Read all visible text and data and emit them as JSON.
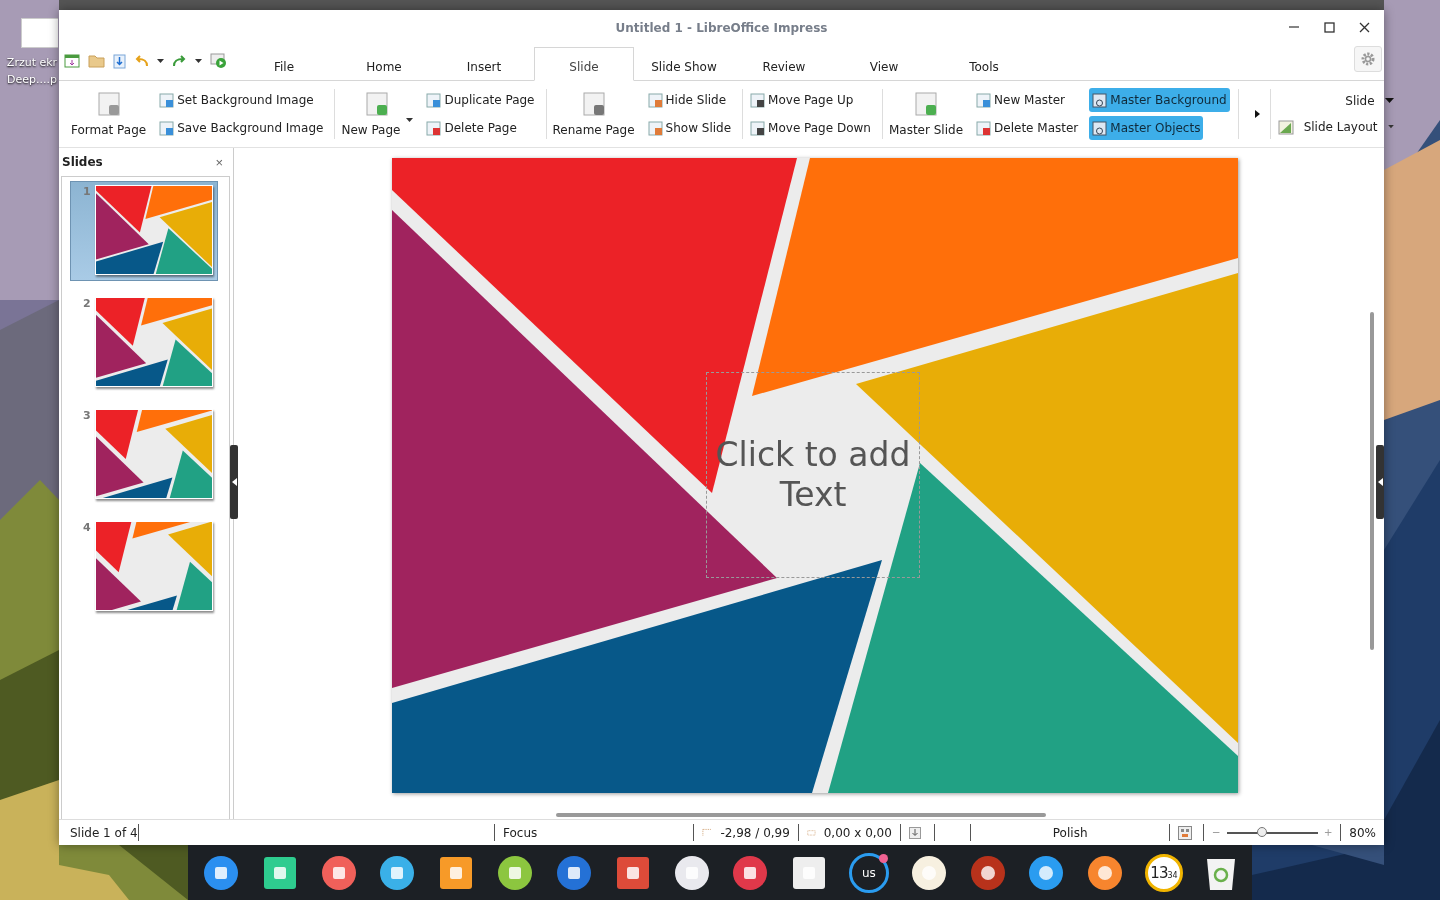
{
  "desktop_icon": {
    "label_line_1": "Zrzut ekr",
    "label_line_2": "Deep....p"
  },
  "window": {
    "title": "Untitled 1 - LibreOffice Impress"
  },
  "tabs": [
    {
      "label": "File",
      "selected": false
    },
    {
      "label": "Home",
      "selected": false
    },
    {
      "label": "Insert",
      "selected": false
    },
    {
      "label": "Slide",
      "selected": true
    },
    {
      "label": "Slide Show",
      "selected": false
    },
    {
      "label": "Review",
      "selected": false
    },
    {
      "label": "View",
      "selected": false
    },
    {
      "label": "Tools",
      "selected": false
    }
  ],
  "ribbon": {
    "groups": [
      {
        "items": [
          {
            "kind": "large",
            "label": "Format Page"
          },
          {
            "kind": "small",
            "label": "Set Background Image"
          },
          {
            "kind": "small",
            "label": "Save Background Image"
          }
        ]
      },
      {
        "items": [
          {
            "kind": "large",
            "label": "New Page",
            "dropdown": true
          },
          {
            "kind": "small",
            "label": "Duplicate Page"
          },
          {
            "kind": "small",
            "label": "Delete Page"
          }
        ]
      },
      {
        "items": [
          {
            "kind": "large",
            "label": "Rename Page"
          },
          {
            "kind": "small",
            "label": "Hide Slide"
          },
          {
            "kind": "small",
            "label": "Show Slide"
          }
        ]
      },
      {
        "items": [
          {
            "kind": "small",
            "label": "Move Page Up"
          },
          {
            "kind": "small",
            "label": "Move Page Down"
          }
        ]
      },
      {
        "items": [
          {
            "kind": "large",
            "label": "Master Slide"
          },
          {
            "kind": "small",
            "label": "New Master"
          },
          {
            "kind": "small",
            "label": "Delete Master"
          },
          {
            "kind": "toggle",
            "label": "Master Background",
            "on": true
          },
          {
            "kind": "toggle",
            "label": "Master Objects",
            "on": true
          }
        ]
      }
    ],
    "right": {
      "slide_menu": "Slide",
      "layout_menu": "Slide Layout"
    }
  },
  "slide_pane": {
    "title": "Slides",
    "close": "×",
    "slides": [
      {
        "number": "1",
        "selected": true
      },
      {
        "number": "2",
        "selected": false
      },
      {
        "number": "3",
        "selected": false
      },
      {
        "number": "4",
        "selected": false
      }
    ]
  },
  "slide": {
    "placeholder": "Click to add Text"
  },
  "status_bar": {
    "slide": "Slide 1 of 4",
    "mode": "Focus",
    "position": "-2,98 / 0,99",
    "size": "0,00 x 0,00",
    "language": "Polish",
    "zoom_slider": {
      "level": 0.39
    },
    "zoom": "80%"
  },
  "dock": {
    "keyboard": "us",
    "clock_hours": "13",
    "clock_minutes": "34"
  }
}
